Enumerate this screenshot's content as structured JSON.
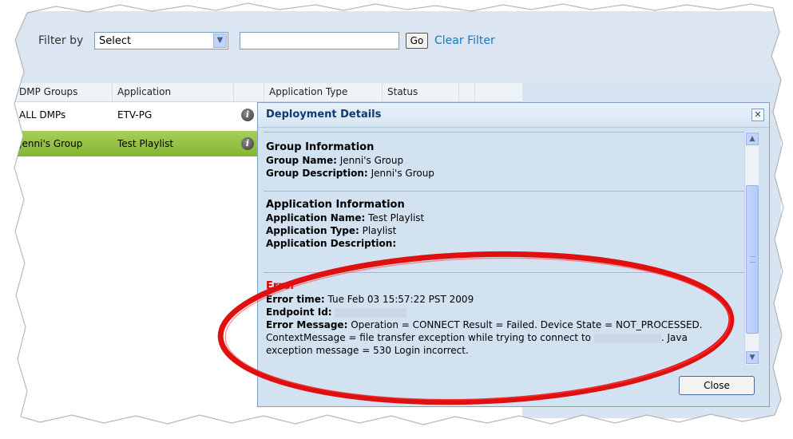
{
  "filter": {
    "label": "Filter by",
    "select_value": "Select",
    "text_value": "",
    "go_label": "Go",
    "clear_label": "Clear Filter"
  },
  "grid": {
    "columns": [
      "DMP Groups",
      "Application",
      "",
      "Application Type",
      "Status"
    ],
    "rows": [
      {
        "group": "ALL DMPs",
        "application": "ETV-PG",
        "selected": false
      },
      {
        "group": "Jenni's Group",
        "application": "Test Playlist",
        "selected": true
      }
    ]
  },
  "dialog": {
    "title": "Deployment Details",
    "close_label": "Close",
    "group_section": {
      "heading": "Group Information",
      "name_label": "Group Name:",
      "name_value": "Jenni's Group",
      "desc_label": "Group Description:",
      "desc_value": "Jenni's Group"
    },
    "app_section": {
      "heading": "Application Information",
      "name_label": "Application Name:",
      "name_value": "Test Playlist",
      "type_label": "Application Type:",
      "type_value": "Playlist",
      "desc_label": "Application Description:"
    },
    "error_section": {
      "heading": "Error",
      "time_label": "Error time:",
      "time_value": "Tue Feb 03 15:57:22 PST 2009",
      "endpoint_label": "Endpoint Id:",
      "message_label": "Error Message:",
      "message_part1": "Operation = CONNECT Result = Failed. Device State = NOT_PROCESSED.",
      "message_part2": "ContextMessage = file transfer exception while trying to connect to",
      "message_part3": ". Java",
      "message_part4": "exception message = 530 Login incorrect."
    }
  },
  "colors": {
    "selected_row": "#9bc84a",
    "error_heading": "#e00000",
    "annotation_ellipse": "#e01010",
    "link": "#1578c5"
  }
}
